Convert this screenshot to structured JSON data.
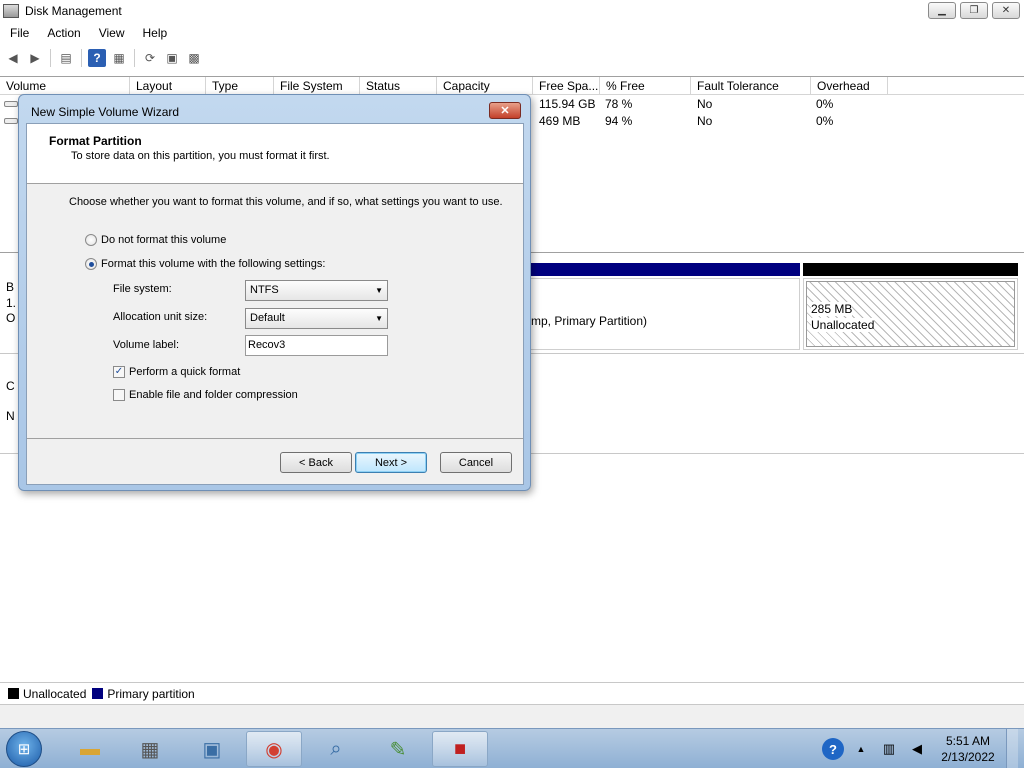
{
  "window": {
    "title": "Disk Management"
  },
  "menu": [
    "File",
    "Action",
    "View",
    "Help"
  ],
  "volume_list": {
    "columns": [
      "Volume",
      "Layout",
      "Type",
      "File System",
      "Status",
      "Capacity",
      "Free Spa...",
      "% Free",
      "Fault Tolerance",
      "Overhead"
    ],
    "rows": [
      {
        "free_space": "115.94 GB",
        "pct_free": "78 %",
        "fault_tolerance": "No",
        "overhead": "0%"
      },
      {
        "free_space": "469 MB",
        "pct_free": "94 %",
        "fault_tolerance": "No",
        "overhead": "0%"
      }
    ]
  },
  "graph": {
    "left_labels": [
      "B",
      "1.",
      "O",
      "C",
      "N"
    ],
    "primary_partition_text": "mp, Primary Partition)",
    "unallocated_size": "285 MB",
    "unallocated_label": "Unallocated"
  },
  "legend": [
    {
      "label": "Unallocated",
      "color": "#000000"
    },
    {
      "label": "Primary partition",
      "color": "#00007f"
    }
  ],
  "dialog": {
    "title": "New Simple Volume Wizard",
    "close_label": "✕",
    "heading": "Format Partition",
    "subheading": "To store data on this partition, you must format it first.",
    "prompt": "Choose whether you want to format this volume, and if so, what settings you want to use.",
    "radio_no_format": "Do not format this volume",
    "radio_format": "Format this volume with the following settings:",
    "file_system_label": "File system:",
    "file_system_value": "NTFS",
    "allocation_label": "Allocation unit size:",
    "allocation_value": "Default",
    "volume_label_label": "Volume label:",
    "volume_label_value": "Recov3",
    "quick_format_label": "Perform a quick format",
    "quick_format_checked": true,
    "compression_label": "Enable file and folder compression",
    "compression_checked": false,
    "back_label": "< Back",
    "next_label": "Next >",
    "cancel_label": "Cancel"
  },
  "taskbar": {
    "apps": [
      "file-explorer",
      "calculator",
      "remote-desktop",
      "chrome",
      "search-computer",
      "notepad-chart",
      "toolbox"
    ],
    "clock_time": "5:51 AM",
    "clock_date": "2/13/2022"
  }
}
